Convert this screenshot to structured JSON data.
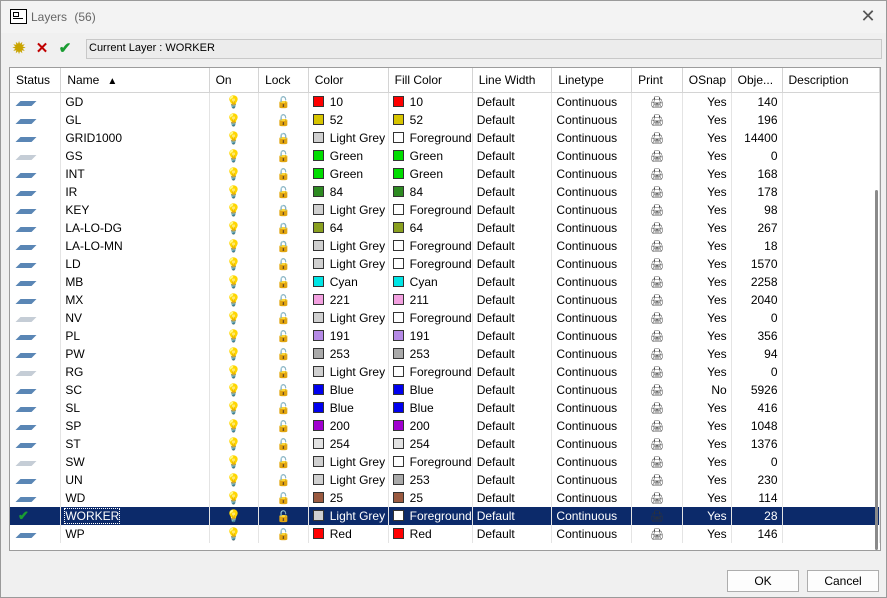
{
  "window": {
    "title": "Layers",
    "count": "(56)"
  },
  "toolbar": {
    "new_icon": "new-layer-icon",
    "delete_icon": "delete-layer-icon",
    "set_current_icon": "set-current-icon"
  },
  "current_layer": "Current Layer : WORKER",
  "columns": [
    "Status",
    "Name",
    "On",
    "Lock",
    "Color",
    "Fill Color",
    "Line Width",
    "Linetype",
    "Print",
    "OSnap",
    "Obje...",
    "Description"
  ],
  "sort_indicator": "▲",
  "rows": [
    {
      "name": "GD",
      "color": "10",
      "color_hex": "#ff0000",
      "fill": "10",
      "fill_hex": "#ff0000",
      "lw": "Default",
      "lt": "Continuous",
      "osnap": "Yes",
      "objects": "140",
      "locked": false,
      "dim": false
    },
    {
      "name": "GL",
      "color": "52",
      "color_hex": "#d7c400",
      "fill": "52",
      "fill_hex": "#d7c400",
      "lw": "Default",
      "lt": "Continuous",
      "osnap": "Yes",
      "objects": "196",
      "locked": false,
      "dim": false
    },
    {
      "name": "GRID1000",
      "color": "Light Grey",
      "color_hex": "#d0d0d0",
      "fill": "Foreground",
      "fill_hex": "#ffffff",
      "lw": "Default",
      "lt": "Continuous",
      "osnap": "Yes",
      "objects": "14400",
      "locked": true,
      "dim": false
    },
    {
      "name": "GS",
      "color": "Green",
      "color_hex": "#00dd00",
      "fill": "Green",
      "fill_hex": "#00dd00",
      "lw": "Default",
      "lt": "Continuous",
      "osnap": "Yes",
      "objects": "0",
      "locked": false,
      "dim": true
    },
    {
      "name": "INT",
      "color": "Green",
      "color_hex": "#00dd00",
      "fill": "Green",
      "fill_hex": "#00dd00",
      "lw": "Default",
      "lt": "Continuous",
      "osnap": "Yes",
      "objects": "168",
      "locked": false,
      "dim": false
    },
    {
      "name": "IR",
      "color": "84",
      "color_hex": "#2e8b22",
      "fill": "84",
      "fill_hex": "#2e8b22",
      "lw": "Default",
      "lt": "Continuous",
      "osnap": "Yes",
      "objects": "178",
      "locked": false,
      "dim": false
    },
    {
      "name": "KEY",
      "color": "Light Grey",
      "color_hex": "#d0d0d0",
      "fill": "Foreground",
      "fill_hex": "#ffffff",
      "lw": "Default",
      "lt": "Continuous",
      "osnap": "Yes",
      "objects": "98",
      "locked": true,
      "dim": false
    },
    {
      "name": "LA-LO-DG",
      "color": "64",
      "color_hex": "#8aa020",
      "fill": "64",
      "fill_hex": "#8aa020",
      "lw": "Default",
      "lt": "Continuous",
      "osnap": "Yes",
      "objects": "267",
      "locked": true,
      "dim": false
    },
    {
      "name": "LA-LO-MN",
      "color": "Light Grey",
      "color_hex": "#d0d0d0",
      "fill": "Foreground",
      "fill_hex": "#ffffff",
      "lw": "Default",
      "lt": "Continuous",
      "osnap": "Yes",
      "objects": "18",
      "locked": true,
      "dim": false
    },
    {
      "name": "LD",
      "color": "Light Grey",
      "color_hex": "#d0d0d0",
      "fill": "Foreground",
      "fill_hex": "#ffffff",
      "lw": "Default",
      "lt": "Continuous",
      "osnap": "Yes",
      "objects": "1570",
      "locked": false,
      "dim": false
    },
    {
      "name": "MB",
      "color": "Cyan",
      "color_hex": "#00e5e5",
      "fill": "Cyan",
      "fill_hex": "#00e5e5",
      "lw": "Default",
      "lt": "Continuous",
      "osnap": "Yes",
      "objects": "2258",
      "locked": false,
      "dim": false
    },
    {
      "name": "MX",
      "color": "221",
      "color_hex": "#f2a0e0",
      "fill": "211",
      "fill_hex": "#f2a0e0",
      "lw": "Default",
      "lt": "Continuous",
      "osnap": "Yes",
      "objects": "2040",
      "locked": false,
      "dim": false
    },
    {
      "name": "NV",
      "color": "Light Grey",
      "color_hex": "#d0d0d0",
      "fill": "Foreground",
      "fill_hex": "#ffffff",
      "lw": "Default",
      "lt": "Continuous",
      "osnap": "Yes",
      "objects": "0",
      "locked": false,
      "dim": true
    },
    {
      "name": "PL",
      "color": "191",
      "color_hex": "#b58ae6",
      "fill": "191",
      "fill_hex": "#b58ae6",
      "lw": "Default",
      "lt": "Continuous",
      "osnap": "Yes",
      "objects": "356",
      "locked": false,
      "dim": false
    },
    {
      "name": "PW",
      "color": "253",
      "color_hex": "#aaaaaa",
      "fill": "253",
      "fill_hex": "#aaaaaa",
      "lw": "Default",
      "lt": "Continuous",
      "osnap": "Yes",
      "objects": "94",
      "locked": false,
      "dim": false
    },
    {
      "name": "RG",
      "color": "Light Grey",
      "color_hex": "#d0d0d0",
      "fill": "Foreground",
      "fill_hex": "#ffffff",
      "lw": "Default",
      "lt": "Continuous",
      "osnap": "Yes",
      "objects": "0",
      "locked": false,
      "dim": true
    },
    {
      "name": "SC",
      "color": "Blue",
      "color_hex": "#0000ee",
      "fill": "Blue",
      "fill_hex": "#0000ee",
      "lw": "Default",
      "lt": "Continuous",
      "osnap": "No",
      "objects": "5926",
      "locked": false,
      "dim": false
    },
    {
      "name": "SL",
      "color": "Blue",
      "color_hex": "#0000ee",
      "fill": "Blue",
      "fill_hex": "#0000ee",
      "lw": "Default",
      "lt": "Continuous",
      "osnap": "Yes",
      "objects": "416",
      "locked": false,
      "dim": false
    },
    {
      "name": "SP",
      "color": "200",
      "color_hex": "#a000d0",
      "fill": "200",
      "fill_hex": "#a000d0",
      "lw": "Default",
      "lt": "Continuous",
      "osnap": "Yes",
      "objects": "1048",
      "locked": false,
      "dim": false
    },
    {
      "name": "ST",
      "color": "254",
      "color_hex": "#e2e2e2",
      "fill": "254",
      "fill_hex": "#e2e2e2",
      "lw": "Default",
      "lt": "Continuous",
      "osnap": "Yes",
      "objects": "1376",
      "locked": false,
      "dim": false
    },
    {
      "name": "SW",
      "color": "Light Grey",
      "color_hex": "#d0d0d0",
      "fill": "Foreground",
      "fill_hex": "#ffffff",
      "lw": "Default",
      "lt": "Continuous",
      "osnap": "Yes",
      "objects": "0",
      "locked": false,
      "dim": true
    },
    {
      "name": "UN",
      "color": "Light Grey",
      "color_hex": "#d0d0d0",
      "fill": "253",
      "fill_hex": "#aaaaaa",
      "lw": "Default",
      "lt": "Continuous",
      "osnap": "Yes",
      "objects": "230",
      "locked": false,
      "dim": false
    },
    {
      "name": "WD",
      "color": "25",
      "color_hex": "#9a5a40",
      "fill": "25",
      "fill_hex": "#9a5a40",
      "lw": "Default",
      "lt": "Continuous",
      "osnap": "Yes",
      "objects": "114",
      "locked": false,
      "dim": false
    },
    {
      "name": "WORKER",
      "color": "Light Grey",
      "color_hex": "#d0d0d0",
      "fill": "Foreground",
      "fill_hex": "#ffffff",
      "lw": "Default",
      "lt": "Continuous",
      "osnap": "Yes",
      "objects": "28",
      "locked": false,
      "dim": false,
      "current": true
    },
    {
      "name": "WP",
      "color": "Red",
      "color_hex": "#ff0000",
      "fill": "Red",
      "fill_hex": "#ff0000",
      "lw": "Default",
      "lt": "Continuous",
      "osnap": "Yes",
      "objects": "146",
      "locked": false,
      "dim": false
    }
  ],
  "buttons": {
    "ok": "OK",
    "cancel": "Cancel"
  }
}
